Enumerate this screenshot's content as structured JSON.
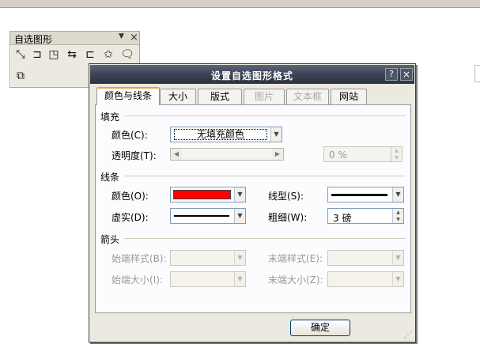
{
  "toolbar": {
    "title": "自选图形",
    "icons": [
      "lines-icon",
      "connectors-icon",
      "basic-shapes-icon",
      "block-arrows-icon",
      "flowchart-icon",
      "stars-banners-icon",
      "callouts-icon",
      "more-autoshapes-icon"
    ]
  },
  "dialog": {
    "title": "设置自选图形格式",
    "tabs": [
      {
        "label": "颜色与线条",
        "active": true,
        "enabled": true
      },
      {
        "label": "大小",
        "active": false,
        "enabled": true
      },
      {
        "label": "版式",
        "active": false,
        "enabled": true
      },
      {
        "label": "图片",
        "active": false,
        "enabled": false
      },
      {
        "label": "文本框",
        "active": false,
        "enabled": false
      },
      {
        "label": "网站",
        "active": false,
        "enabled": true
      }
    ],
    "fill": {
      "heading": "填充",
      "color_label": "颜色(C):",
      "color_value": "无填充颜色",
      "transparency_label": "透明度(T):",
      "transparency_value": "0 %"
    },
    "line": {
      "heading": "线条",
      "color_label": "颜色(O):",
      "color_hex": "#ff0000",
      "dash_label": "虚实(D):",
      "style_label": "线型(S):",
      "weight_label": "粗细(W):",
      "weight_value": "3 磅"
    },
    "arrows": {
      "heading": "箭头",
      "begin_style_label": "始端样式(B):",
      "end_style_label": "末端样式(E):",
      "begin_size_label": "始端大小(I):",
      "end_size_label": "末端大小(Z):"
    },
    "ok_label": "确定",
    "help_label": "?",
    "close_label": "×"
  }
}
